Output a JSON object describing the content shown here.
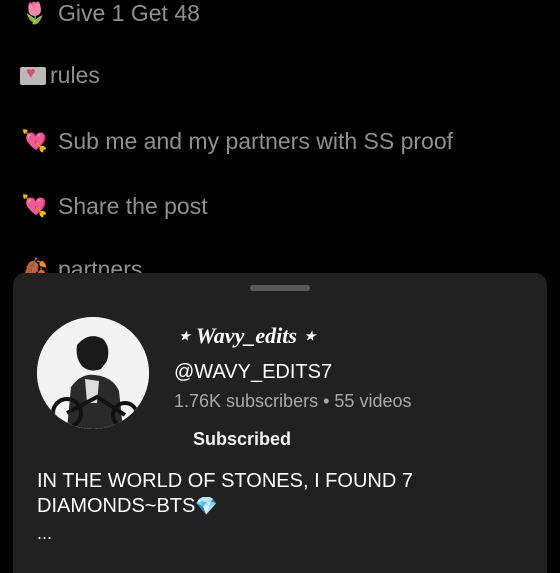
{
  "post": {
    "lines": [
      {
        "icon": "tulip-icon",
        "text": "Give 1 Get 48"
      },
      {
        "icon": "love-letter-icon",
        "text": "rules"
      },
      {
        "icon": "heart-arrow-icon",
        "text": "Sub me and my partners with SS proof"
      },
      {
        "icon": "heart-arrow-icon",
        "text": "Share the post"
      },
      {
        "icon": "leaf-icon",
        "text": "partners"
      }
    ]
  },
  "channel": {
    "name": "⋆ Wavy_edits ⋆",
    "handle": "@WAVY_EDITS7",
    "subscribers": "1.76K subscribers",
    "videos": "55 videos",
    "separator": "•",
    "subscribe_label": "Subscribed",
    "description": "IN THE WORLD OF STONES, I FOUND 7 DIAMONDS~BTS",
    "more": "..."
  },
  "colors": {
    "background": "#000000",
    "sheet": "#212121",
    "muted_text": "#8f8f8f",
    "diamond": "#6ad4ff"
  }
}
